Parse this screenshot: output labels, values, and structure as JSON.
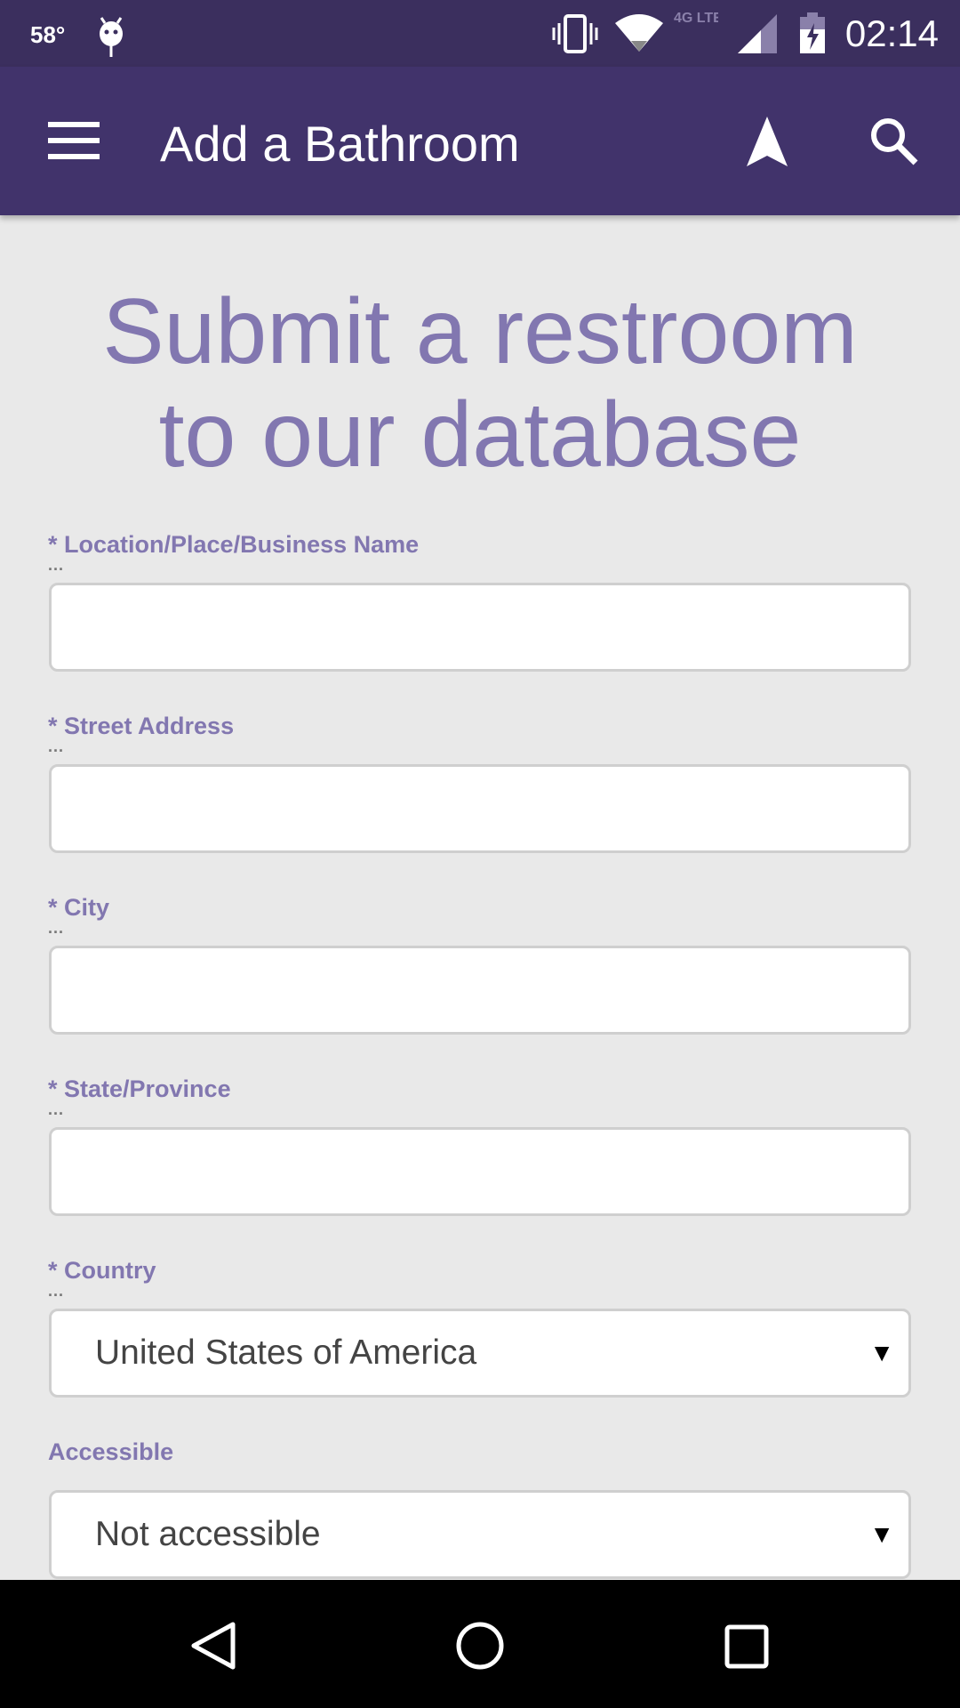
{
  "status_bar": {
    "temperature": "58°",
    "time": "02:14",
    "network": "4G LTE",
    "icons": [
      "android-icon",
      "vibrate-icon",
      "wifi-icon",
      "signal-icon",
      "battery-charging-icon"
    ]
  },
  "app_bar": {
    "title": "Add a Bathroom",
    "icons": [
      "menu-icon",
      "navigation-icon",
      "search-icon"
    ],
    "color": "#41336b"
  },
  "heading": {
    "line1": "Submit a restroom",
    "line2": "to our database"
  },
  "form": {
    "fields": [
      {
        "label": "* Location/Place/Business Name",
        "value": ""
      },
      {
        "label": "* Street Address",
        "value": ""
      },
      {
        "label": "* City",
        "value": ""
      },
      {
        "label": "* State/Province",
        "value": ""
      }
    ],
    "country": {
      "label": "* Country",
      "value": "United States of America"
    },
    "accessible": {
      "label": "Accessible",
      "value": "Not accessible"
    }
  },
  "accent_color": "#8277b0"
}
